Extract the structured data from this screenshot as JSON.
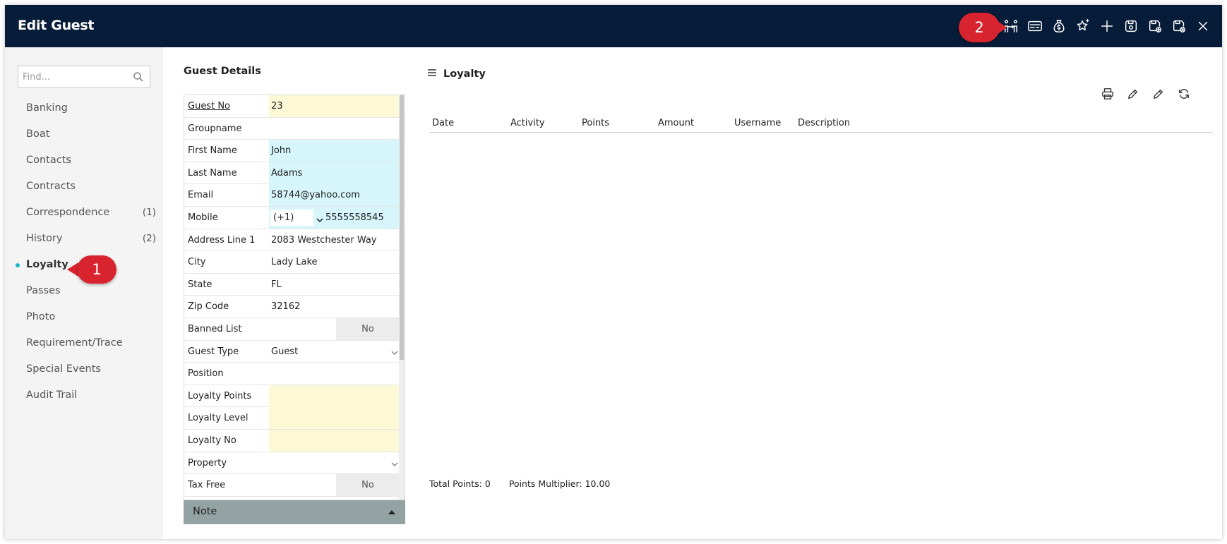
{
  "window": {
    "title": "Edit Guest"
  },
  "toolbar": {
    "icons": [
      "people-connection-icon",
      "id-card-icon",
      "money-bag-icon",
      "star-sparkle-icon",
      "plus-icon",
      "save-icon",
      "save-add-icon",
      "save-close-icon",
      "close-icon"
    ]
  },
  "callouts": {
    "one": "1",
    "two": "2"
  },
  "sidebar": {
    "find_placeholder": "Find...",
    "items": [
      {
        "label": "Banking",
        "count": ""
      },
      {
        "label": "Boat",
        "count": ""
      },
      {
        "label": "Contacts",
        "count": ""
      },
      {
        "label": "Contracts",
        "count": ""
      },
      {
        "label": "Correspondence",
        "count": "(1)"
      },
      {
        "label": "History",
        "count": "(2)"
      },
      {
        "label": "Loyalty",
        "count": "",
        "active": true
      },
      {
        "label": "Passes",
        "count": ""
      },
      {
        "label": "Photo",
        "count": ""
      },
      {
        "label": "Requirement/Trace",
        "count": ""
      },
      {
        "label": "Special Events",
        "count": ""
      },
      {
        "label": "Audit Trail",
        "count": ""
      }
    ]
  },
  "guest_details": {
    "title": "Guest Details",
    "fields": {
      "guest_no": {
        "label": "Guest No",
        "value": "23"
      },
      "groupname": {
        "label": "Groupname",
        "value": ""
      },
      "first_name": {
        "label": "First Name",
        "value": "John"
      },
      "last_name": {
        "label": "Last Name",
        "value": "Adams"
      },
      "email": {
        "label": "Email",
        "value": "58744@yahoo.com"
      },
      "mobile": {
        "label": "Mobile",
        "code": "(+1)",
        "value": "5555558545"
      },
      "address1": {
        "label": "Address Line 1",
        "value": "2083 Westchester Way"
      },
      "city": {
        "label": "City",
        "value": "Lady Lake"
      },
      "state": {
        "label": "State",
        "value": "FL"
      },
      "zip": {
        "label": "Zip Code",
        "value": "32162"
      },
      "banned": {
        "label": "Banned List",
        "value": "No"
      },
      "guest_type": {
        "label": "Guest Type",
        "value": "Guest"
      },
      "position": {
        "label": "Position",
        "value": ""
      },
      "loyalty_points": {
        "label": "Loyalty Points",
        "value": ""
      },
      "loyalty_level": {
        "label": "Loyalty Level",
        "value": ""
      },
      "loyalty_no": {
        "label": "Loyalty No",
        "value": ""
      },
      "property": {
        "label": "Property",
        "value": ""
      },
      "tax_free": {
        "label": "Tax Free",
        "value": "No"
      }
    },
    "note_label": "Note"
  },
  "loyalty": {
    "title": "Loyalty",
    "columns": [
      "Date",
      "Activity",
      "Points",
      "Amount",
      "Username",
      "Description"
    ],
    "total_points": "Total Points: 0",
    "multiplier": "Points Multiplier: 10.00"
  },
  "colors": {
    "titlebar": "#061c38",
    "callout": "#d8242f",
    "active_dot": "#1ab7c9",
    "yellow_field": "#fdf9d6",
    "cyan_field": "#d6f6fb"
  }
}
